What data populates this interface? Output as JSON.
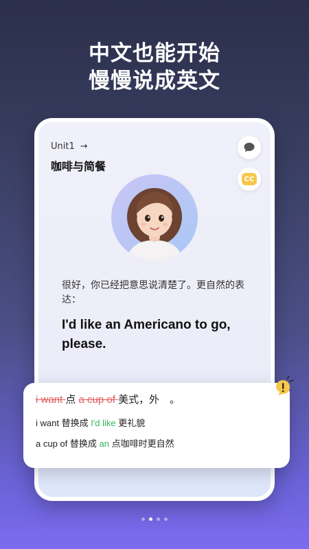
{
  "headline": {
    "line1": "中文也能开始",
    "line2": "慢慢说成英文"
  },
  "lesson": {
    "unit_label": "Unit1",
    "unit_arrow": "→",
    "title": "咖啡与简餐"
  },
  "controls": {
    "chat_icon": "chat-bubble-icon",
    "cc_label": "CC"
  },
  "tutor": {
    "avatar_icon": "tutor-avatar",
    "prompt": "很好，你已经把意思说清楚了。更自然的表达：",
    "answer": "I'd like an Americano to go, please."
  },
  "correction": {
    "line1": {
      "wrong1": "i want ",
      "mid1": "点 ",
      "wrong2": "a cup of ",
      "rest": "美式，外　。"
    },
    "line2": {
      "pre": "i want 替换成 ",
      "green": "I'd like",
      "post": " 更礼貌"
    },
    "line3": {
      "pre": "a cup of 替换成 ",
      "green": "an",
      "post": " 点咖啡时更自然"
    }
  },
  "pagination": {
    "count": 4,
    "active_index": 1
  },
  "colors": {
    "accent_green": "#33b45a",
    "accent_red": "#e05a5a",
    "cc_yellow": "#f6c74a"
  }
}
